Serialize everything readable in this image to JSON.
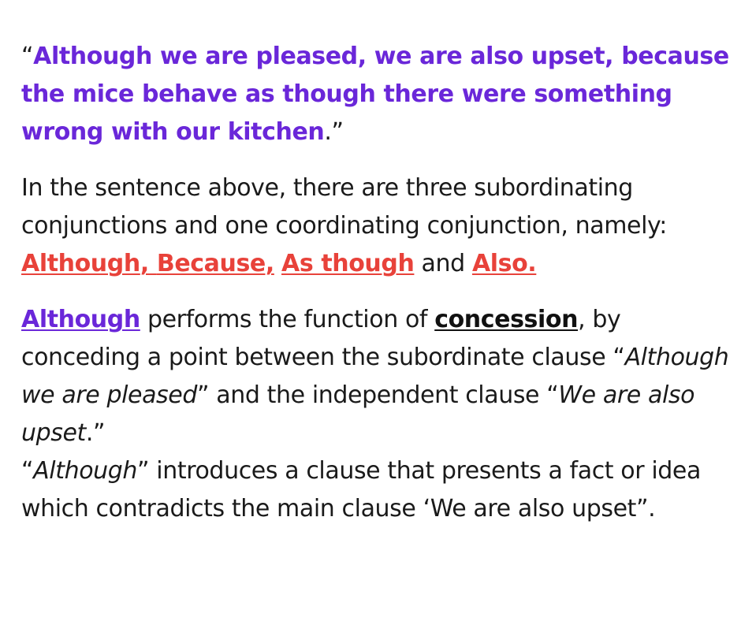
{
  "quote": {
    "open": "“",
    "text": "Although we are pleased, we are also upset, because the mice behave as though there were something wrong with our kitchen",
    "close": ".”"
  },
  "intro": {
    "text": "In the sentence above, there are three subordinating conjunctions and one coordinating conjunction, namely: ",
    "conj1": "Although",
    "sep1": ", ",
    "conj2": "Because,",
    "sep2": " ",
    "conj3": "As though",
    "and_word": " and ",
    "conj4": "Also."
  },
  "explanation": {
    "term": "Although",
    "t1": " performs the function of ",
    "concept": "concession",
    "t2": ", by conceding a point between the subordinate clause “",
    "sub_clause": "Although we are pleased",
    "t3": "” and the independent clause “",
    "main_clause": "We are also upset",
    "t4": ".”",
    "q_open": "“",
    "term2": "Although",
    "t5": "” introduces a clause that presents a fact or idea which contradicts the main clause ‘We are also upset”."
  },
  "colors": {
    "purple": "#6a27d9",
    "red": "#e8423a",
    "text": "#1a1a1a",
    "background": "#ffffff"
  }
}
